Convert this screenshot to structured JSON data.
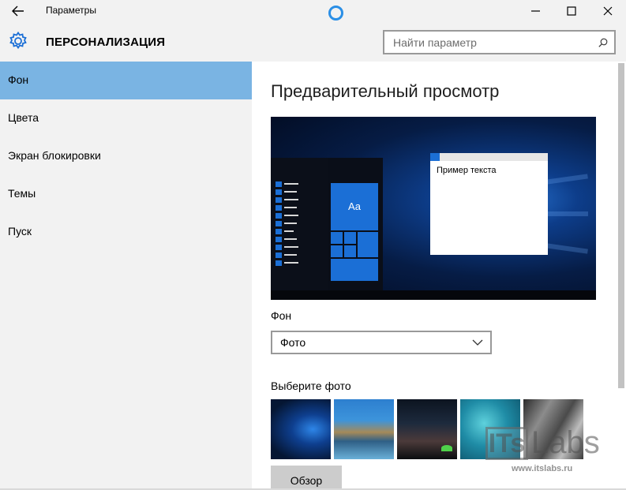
{
  "window": {
    "title": "Параметры"
  },
  "header": {
    "title": "ПЕРСОНАЛИЗАЦИЯ",
    "search_placeholder": "Найти параметр"
  },
  "sidebar": {
    "items": [
      {
        "label": "Фон",
        "active": true
      },
      {
        "label": "Цвета",
        "active": false
      },
      {
        "label": "Экран блокировки",
        "active": false
      },
      {
        "label": "Темы",
        "active": false
      },
      {
        "label": "Пуск",
        "active": false
      }
    ]
  },
  "main": {
    "preview_title": "Предварительный просмотр",
    "preview": {
      "tile_label": "Aa",
      "window_text": "Пример текста"
    },
    "background_label": "Фон",
    "background_value": "Фото",
    "choose_photo_label": "Выберите фото",
    "photos": [
      "windows-hero",
      "beach-rocks",
      "night-sky-tent",
      "underwater-swimmer",
      "rock-cliff"
    ],
    "browse_label": "Обзор"
  },
  "watermark": {
    "logo_box": "ITs",
    "logo_word": "Labs",
    "url": "www.itslabs.ru"
  },
  "colors": {
    "accent": "#7ab4e3",
    "chrome": "#f2f2f2",
    "tile_blue": "#1b6fd6",
    "cortana_ring": "#2b8fe6"
  }
}
